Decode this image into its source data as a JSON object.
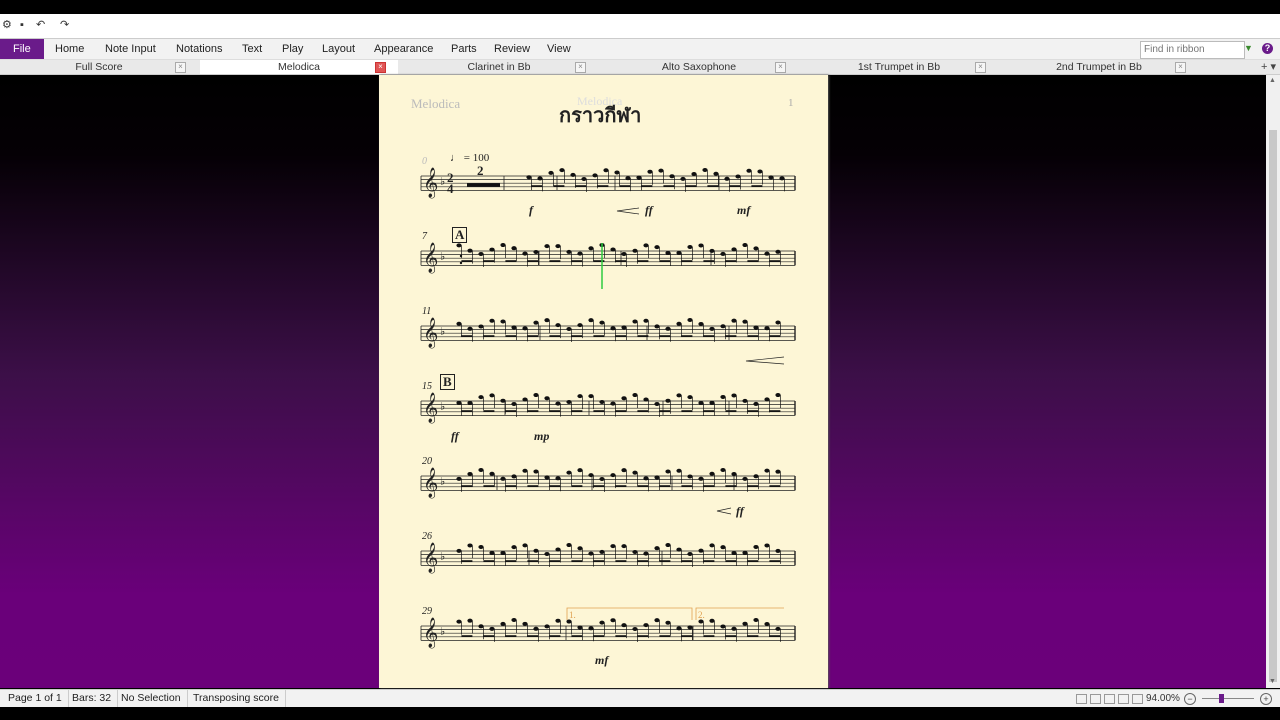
{
  "ribbon": {
    "menus": [
      "File",
      "Home",
      "Note Input",
      "Notations",
      "Text",
      "Play",
      "Layout",
      "Appearance",
      "Parts",
      "Review",
      "View"
    ],
    "search_placeholder": "Find in ribbon",
    "help": "?"
  },
  "tabs": [
    {
      "label": "Full Score",
      "active": false
    },
    {
      "label": "Melodica",
      "active": true
    },
    {
      "label": "Clarinet in Bb",
      "active": false
    },
    {
      "label": "Alto Saxophone",
      "active": false
    },
    {
      "label": "1st Trumpet in Bb",
      "active": false
    },
    {
      "label": "2nd Trumpet in Bb",
      "active": false
    }
  ],
  "score": {
    "part_name": "Melodica",
    "title": "กราวกีฬา",
    "title_ghost": "Melodica",
    "page_number": "1",
    "tempo": "= 100",
    "time_signature_top": "2",
    "time_signature_bottom": "4",
    "multirest_count": "2",
    "rehearsal_marks": [
      "A",
      "B"
    ],
    "ending_labels": [
      "1.",
      "2."
    ],
    "systems": [
      {
        "bar": "0",
        "dynamics": [
          "f",
          "ff",
          "mf"
        ]
      },
      {
        "bar": "7",
        "dynamics": []
      },
      {
        "bar": "11",
        "dynamics": []
      },
      {
        "bar": "15",
        "dynamics": [
          "ff",
          "mp"
        ]
      },
      {
        "bar": "20",
        "dynamics": [
          "ff"
        ]
      },
      {
        "bar": "26",
        "dynamics": []
      },
      {
        "bar": "29",
        "dynamics": [
          "mf"
        ]
      }
    ]
  },
  "status": {
    "page": "Page 1 of 1",
    "bars": "Bars: 32",
    "selection": "No Selection",
    "mode": "Transposing score",
    "zoom": "94.00%"
  },
  "colors": {
    "accent": "#6a1b8a",
    "paper": "#fdf6d6",
    "playback_line": "#2ecc40",
    "ending_bracket": "#e0a050"
  }
}
